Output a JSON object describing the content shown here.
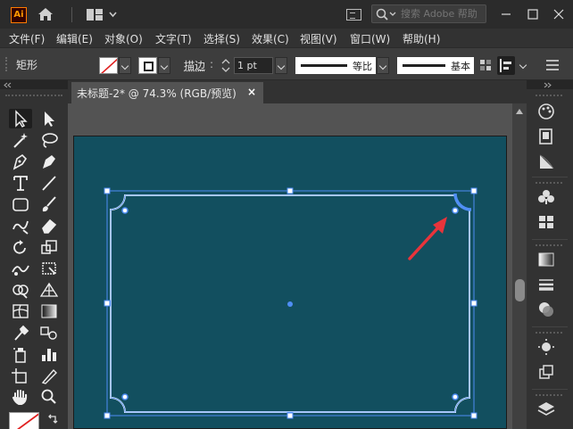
{
  "app": {
    "logo_text": "Ai",
    "search_placeholder": "搜索 Adobe 帮助"
  },
  "menu": [
    "文件(F)",
    "编辑(E)",
    "对象(O)",
    "文字(T)",
    "选择(S)",
    "效果(C)",
    "视图(V)",
    "窗口(W)",
    "帮助(H)"
  ],
  "control": {
    "shape_label": "矩形",
    "stroke_label": "描边",
    "stroke_weight": "1 pt",
    "profile_label": "等比",
    "brush_label": "基本"
  },
  "document": {
    "tab_label": "未标题-2* @ 74.3% (RGB/预览)",
    "close_label": "×"
  },
  "colors": {
    "artboard": "#124f5f",
    "selection": "#4f8ef5",
    "arrow": "#e8343b"
  },
  "icons": [
    "home-icon",
    "layout-icon",
    "search-icon",
    "minimize-icon",
    "maximize-icon",
    "close-icon"
  ]
}
